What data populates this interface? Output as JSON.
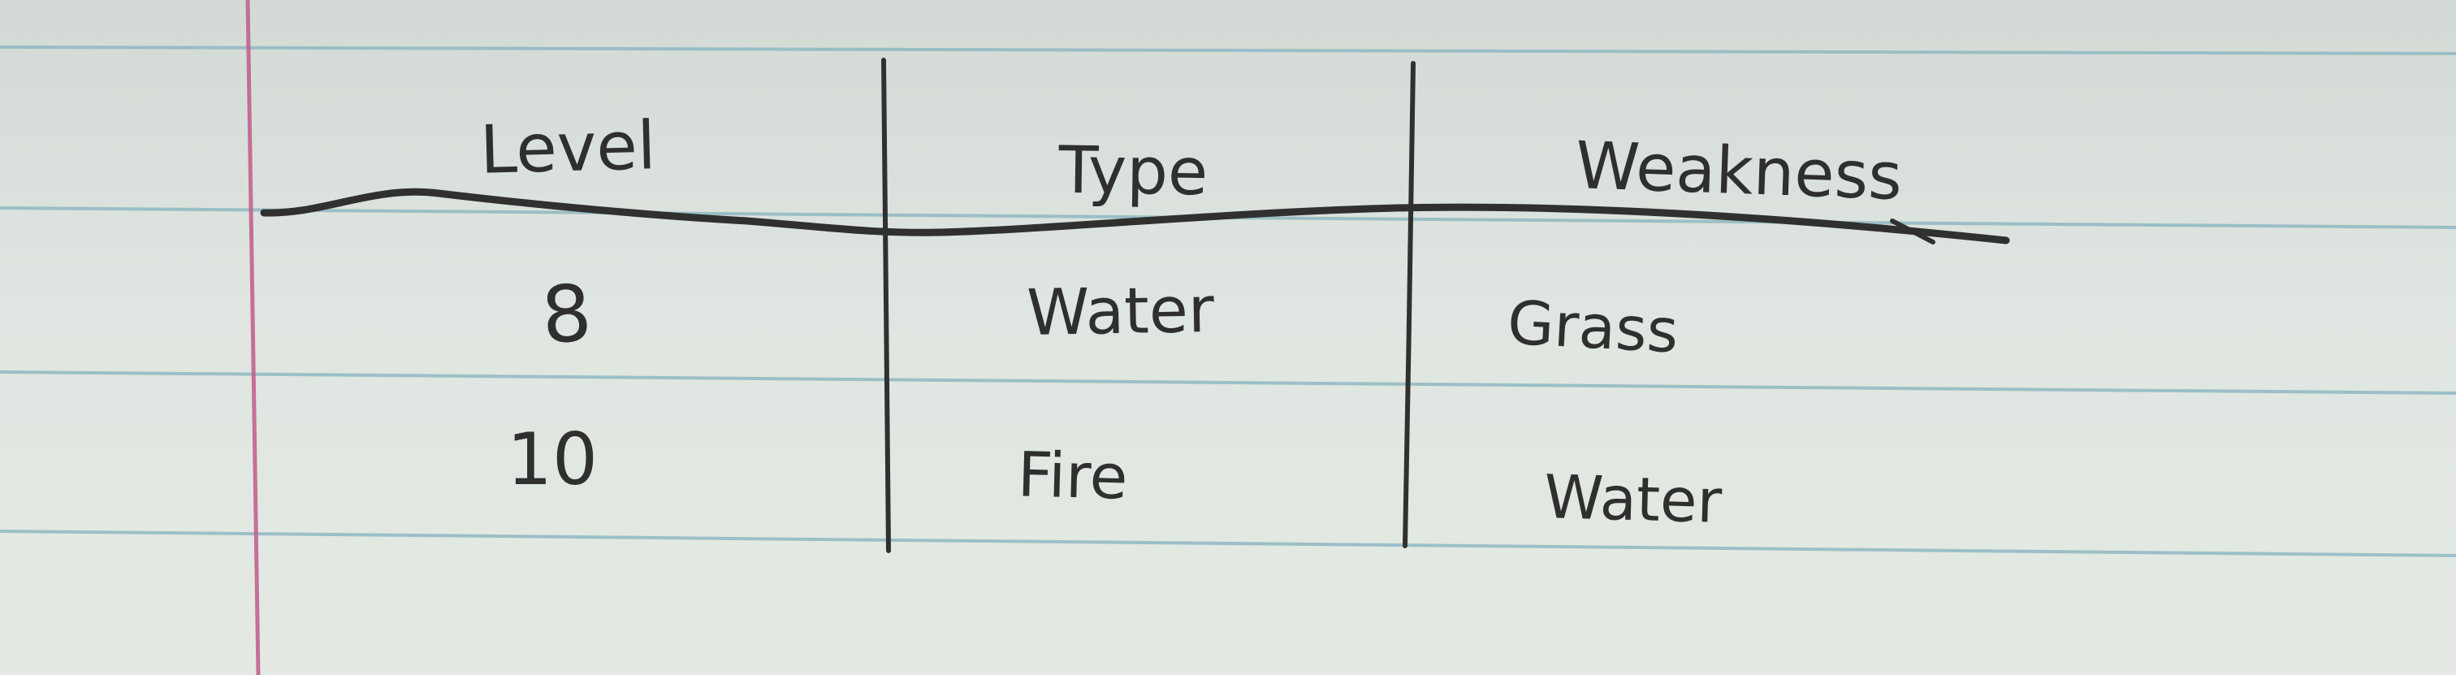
{
  "table": {
    "headers": [
      "Level",
      "Type",
      "Weakness"
    ],
    "rows": [
      [
        "8",
        "Water",
        "Grass"
      ],
      [
        "10",
        "Fire",
        "Water"
      ]
    ]
  },
  "colors": {
    "paper": "#dfe5e0",
    "rule_line": "#8fb7c2",
    "margin_line": "#c05a8c",
    "ink": "#30312f"
  }
}
